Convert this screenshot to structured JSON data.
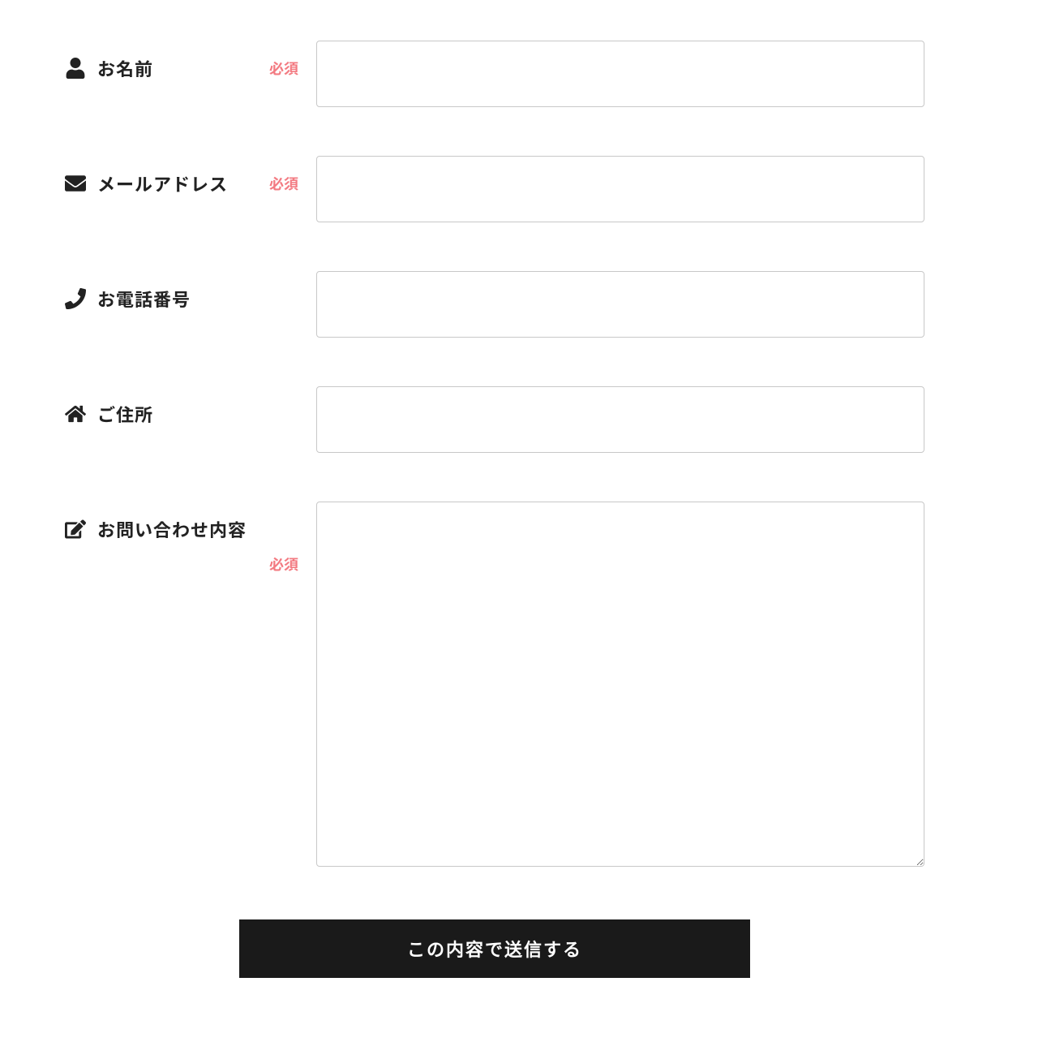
{
  "form": {
    "required_label": "必須",
    "fields": {
      "name": {
        "label": "お名前",
        "required": true,
        "value": ""
      },
      "email": {
        "label": "メールアドレス",
        "required": true,
        "value": ""
      },
      "phone": {
        "label": "お電話番号",
        "required": false,
        "value": ""
      },
      "address": {
        "label": "ご住所",
        "required": false,
        "value": ""
      },
      "inquiry": {
        "label": "お問い合わせ内容",
        "required": true,
        "value": ""
      }
    },
    "submit_label": "この内容で送信する"
  }
}
